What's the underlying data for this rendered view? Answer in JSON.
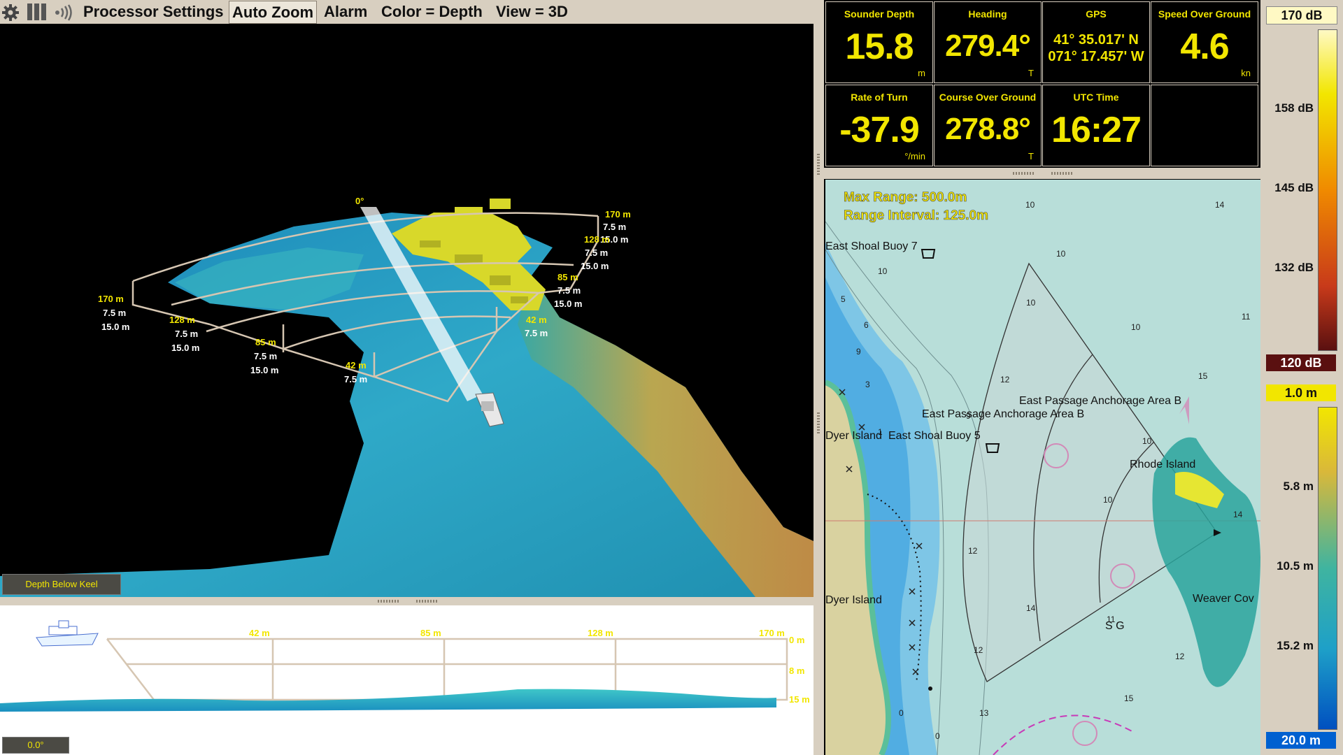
{
  "toolbar": {
    "items": [
      "Processor Settings",
      "Auto Zoom",
      "Alarm",
      "Color = Depth",
      "View = 3D"
    ]
  },
  "view3d": {
    "heading_mark": "0°",
    "depth_button": "Depth Below Keel",
    "ranges": [
      "42 m",
      "85 m",
      "128 m",
      "170 m"
    ],
    "sub_depth_a": "7.5 m",
    "sub_depth_b": "15.0 m",
    "right_ranges": [
      "170 m",
      "128 m",
      "85 m",
      "42 m"
    ]
  },
  "profile": {
    "ranges": [
      "42 m",
      "85 m",
      "128 m",
      "170 m"
    ],
    "depths": [
      "0 m",
      "8 m",
      "15 m"
    ],
    "angle": "0.0°"
  },
  "instruments": [
    {
      "label": "Sounder Depth",
      "value": "15.8",
      "unit": "m"
    },
    {
      "label": "Heading",
      "value": "279.4°",
      "unit": "T"
    },
    {
      "label": "GPS",
      "lat": "41° 35.017' N",
      "lon": "071° 17.457' W"
    },
    {
      "label": "Speed Over Ground",
      "value": "4.6",
      "unit": "kn"
    },
    {
      "label": "Rate of Turn",
      "value": "-37.9",
      "unit": "°/min"
    },
    {
      "label": "Course Over Ground",
      "value": "278.8°",
      "unit": "T"
    },
    {
      "label": "UTC Time",
      "value": "16:27",
      "unit": ""
    }
  ],
  "chart": {
    "max_range": "Max Range: 500.0m",
    "range_interval": "Range Interval: 125.0m",
    "labels": {
      "buoy7": "East Shoal Buoy 7",
      "buoy5": "East Shoal Buoy 5",
      "dyer1": "Dyer Island",
      "dyer2": "Dyer Island",
      "anchorA": "East Passage Anchorage Area B",
      "anchorB": "East Passage Anchorage Area B",
      "rhode": "Rhode Island",
      "weaver": "Weaver Cov",
      "sg": "S G"
    }
  },
  "colorbar": {
    "db_top": "170 dB",
    "db_ticks": [
      "158 dB",
      "145 dB",
      "132 dB"
    ],
    "db_bottom": "120 dB",
    "depth_top": "1.0 m",
    "depth_ticks": [
      "5.8 m",
      "10.5 m",
      "15.2 m"
    ],
    "depth_bottom": "20.0 m"
  },
  "colors": {
    "accent_yellow": "#f2e600",
    "panel": "#d8cfc0",
    "chart_water": "#b8ded9"
  }
}
